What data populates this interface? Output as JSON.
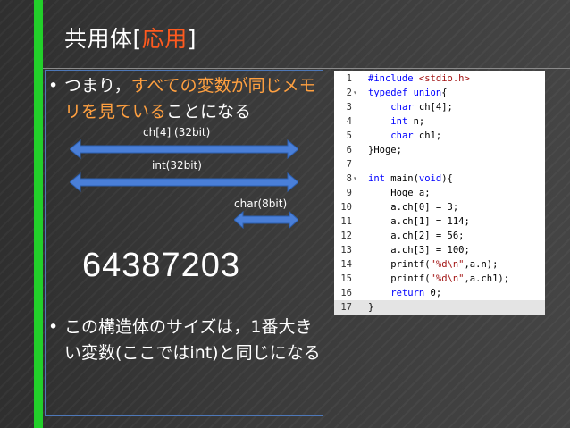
{
  "title": {
    "prefix": "共用体[",
    "highlight": "応用",
    "suffix": "]"
  },
  "bullets": [
    {
      "text_orange": "すべての変数が同じメモリを見ている",
      "text_before": "つまり，",
      "text_after": "ことになる"
    },
    {
      "text": "この構造体のサイズは，1番大きい変数(ここではint)と同じになる"
    }
  ],
  "diagram": {
    "arrow_labels": [
      "ch[4] (32bit)",
      "int(32bit)",
      "char(8bit)"
    ]
  },
  "result_value": "64387203",
  "code": {
    "lines": [
      {
        "n": "1",
        "fold": "",
        "text": "#include <stdio.h>"
      },
      {
        "n": "2",
        "fold": "▾",
        "text": "typedef union{"
      },
      {
        "n": "3",
        "fold": "",
        "text": "    char ch[4];"
      },
      {
        "n": "4",
        "fold": "",
        "text": "    int n;"
      },
      {
        "n": "5",
        "fold": "",
        "text": "    char ch1;"
      },
      {
        "n": "6",
        "fold": "",
        "text": "}Hoge;"
      },
      {
        "n": "7",
        "fold": "",
        "text": ""
      },
      {
        "n": "8",
        "fold": "▾",
        "text": "int main(void){"
      },
      {
        "n": "9",
        "fold": "",
        "text": "    Hoge a;"
      },
      {
        "n": "10",
        "fold": "",
        "text": "    a.ch[0] = 3;"
      },
      {
        "n": "11",
        "fold": "",
        "text": "    a.ch[1] = 114;"
      },
      {
        "n": "12",
        "fold": "",
        "text": "    a.ch[2] = 56;"
      },
      {
        "n": "13",
        "fold": "",
        "text": "    a.ch[3] = 100;"
      },
      {
        "n": "14",
        "fold": "",
        "text": "    printf(\"%d\\n\",a.n);"
      },
      {
        "n": "15",
        "fold": "",
        "text": "    printf(\"%d\\n\",a.ch1);"
      },
      {
        "n": "16",
        "fold": "",
        "text": "    return 0;"
      },
      {
        "n": "17",
        "fold": "",
        "text": "}"
      }
    ]
  },
  "colors": {
    "accent_bar": "#22d02a",
    "title_highlight": "#ff5a1f",
    "bullet_highlight": "#ffa040",
    "arrow": "#4a7fd8"
  }
}
